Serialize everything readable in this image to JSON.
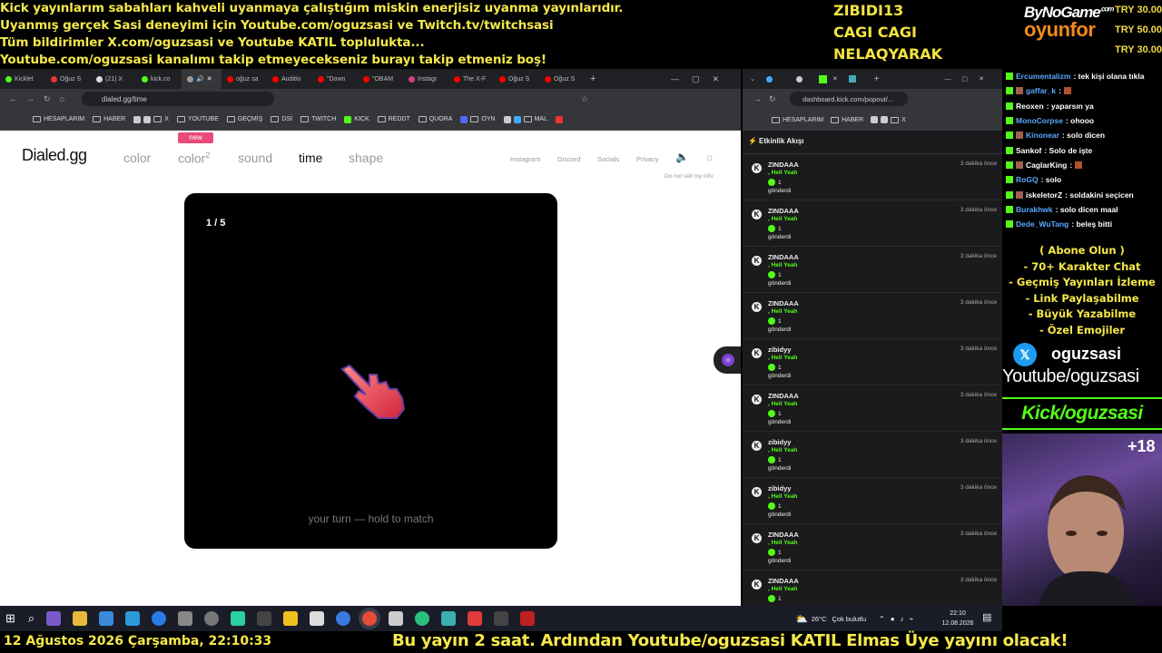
{
  "top_banner": {
    "lines": [
      "Kick yayınlarım sabahları kahveli uyanmaya çalıştığım miskin enerjisiz uyanma yayınlarıdır.",
      "Uyanmış gerçek Sasi deneyimi için Youtube.com/oguzsasi ve Twitch.tv/twitchsasi",
      "Tüm bildirimler X.com/oguzsasi ve Youtube KATIL toplulukta...",
      "Youtube.com/oguzsasi kanalımı takip etmeyecekseniz burayı takip etmeniz boş!"
    ]
  },
  "donors": [
    "ZIBIDI13",
    "CAGI CAGI",
    "NELAQYARAK"
  ],
  "sponsor": {
    "line1": "ByNoGame",
    "line1_sup": ".com",
    "line2": "oyunfor"
  },
  "tips": [
    "TRY 30.00",
    "TRY 50.00",
    "TRY 30.00"
  ],
  "left_browser": {
    "tabs": [
      "Kicklet",
      "Oğuz S",
      "(21) X",
      "kick.co",
      "",
      "oğuz sa",
      "Auditio",
      "\"Down",
      "\"OBAM",
      "Instagr",
      "The X-F",
      "Oğuz S",
      "Oğuz S"
    ],
    "url": "dialed.gg/time",
    "bookmarks": [
      "HESAPLARIM",
      "HABER",
      "X",
      "YOUTUBE",
      "GEÇMİŞ",
      "DSİ",
      "TWITCH",
      "KICK",
      "REDDT",
      "QUORA",
      "OYN",
      "MAL"
    ]
  },
  "site": {
    "logo": "Dialed.gg",
    "nav": {
      "color": "color",
      "color2": "color",
      "color2_sup": "2",
      "sound": "sound",
      "time": "time",
      "shape": "shape"
    },
    "new_badge": "new",
    "secondary_nav": [
      "Instagram",
      "Discord",
      "Socials",
      "Privacy"
    ],
    "do_not_sell": "Do not sell my info",
    "game": {
      "counter": "1 / 5",
      "hint": "your turn — hold to match"
    }
  },
  "right_browser": {
    "url": "dashboard.kick.com/popout/...",
    "bookmarks": [
      "HESAPLARIM",
      "HABER",
      "X"
    ],
    "feed_title": "Etkinlik Akışı",
    "events": [
      {
        "name": "ZINDAAA",
        "item": ", Hell Yeah",
        "qty": "1",
        "action": "gönderdi",
        "time": "3 dakika önce"
      },
      {
        "name": "ZINDAAA",
        "item": ", Hell Yeah",
        "qty": "1",
        "action": "gönderdi",
        "time": "3 dakika önce"
      },
      {
        "name": "ZINDAAA",
        "item": ", Hell Yeah",
        "qty": "1",
        "action": "gönderdi",
        "time": "3 dakika önce"
      },
      {
        "name": "ZINDAAA",
        "item": ", Hell Yeah",
        "qty": "1",
        "action": "gönderdi",
        "time": "3 dakika önce"
      },
      {
        "name": "zibidyy",
        "item": ", Hell Yeah",
        "qty": "1",
        "action": "gönderdi",
        "time": "3 dakika önce"
      },
      {
        "name": "ZINDAAA",
        "item": ", Hell Yeah",
        "qty": "1",
        "action": "gönderdi",
        "time": "3 dakika önce"
      },
      {
        "name": "zibidyy",
        "item": ", Hell Yeah",
        "qty": "1",
        "action": "gönderdi",
        "time": "3 dakika önce"
      },
      {
        "name": "zibidyy",
        "item": ", Hell Yeah",
        "qty": "1",
        "action": "gönderdi",
        "time": "3 dakika önce"
      },
      {
        "name": "ZINDAAA",
        "item": ", Hell Yeah",
        "qty": "1",
        "action": "gönderdi",
        "time": "3 dakika önce"
      },
      {
        "name": "ZINDAAA",
        "item": ", Hell Yeah",
        "qty": "1",
        "action": "",
        "time": "3 dakika önce"
      }
    ]
  },
  "chat": [
    {
      "user": "Ercumentalizm",
      "msg": ": tek kişi olana tıkla",
      "color": "#5aa8ff"
    },
    {
      "user": "gaffar_k",
      "msg": ":",
      "color": "#5aa8ff"
    },
    {
      "user": "Reoxen",
      "msg": ": yaparsın ya",
      "color": "#ffffff"
    },
    {
      "user": "MonoCorpse",
      "msg": ": ohooo",
      "color": "#5aa8ff"
    },
    {
      "user": "Kinonear",
      "msg": ": solo dicen",
      "color": "#5aa8ff"
    },
    {
      "user": "Sankof",
      "msg": ": Solo de işte",
      "color": "#ffffff"
    },
    {
      "user": "CaglarKing",
      "msg": ":",
      "color": "#ffffff"
    },
    {
      "user": "RoGQ",
      "msg": ": solo",
      "color": "#5aa8ff"
    },
    {
      "user": "iskeletorZ",
      "msg": ": soldakini seçicen",
      "color": "#ffffff"
    },
    {
      "user": "Burakhwk",
      "msg": ": solo dicen maal",
      "color": "#5aa8ff"
    },
    {
      "user": "Dede_WuTang",
      "msg": ": beleş bitti",
      "color": "#5aa8ff"
    }
  ],
  "promo": [
    "( Abone Olun )",
    "- 70+ Karakter Chat",
    "- Geçmiş Yayınları İzleme",
    "- Link Paylaşabilme",
    "- Büyük Yazabilme",
    "- Özel Emojiler"
  ],
  "twitter_handle": "oguzsasi",
  "youtube_line": "Youtube/oguzsasi",
  "kick_line": "Kick/oguzsasi",
  "cam_badge": "+18",
  "taskbar": {
    "weather": "26°C",
    "weather_desc": "Çok bulutlu",
    "time": "22:10",
    "date": "12.08.2026"
  },
  "bottom": {
    "date": "12 Ağustos 2026 Çarşamba, 22:10:33",
    "msg": "Bu yayın 2 saat. Ardından Youtube/oguzsasi KATIL Elmas Üye yayını olacak!"
  },
  "colors": {
    "kick_green": "#53fc18",
    "banner_yellow": "#f5e84a",
    "brand_orange": "#f28a1c"
  }
}
